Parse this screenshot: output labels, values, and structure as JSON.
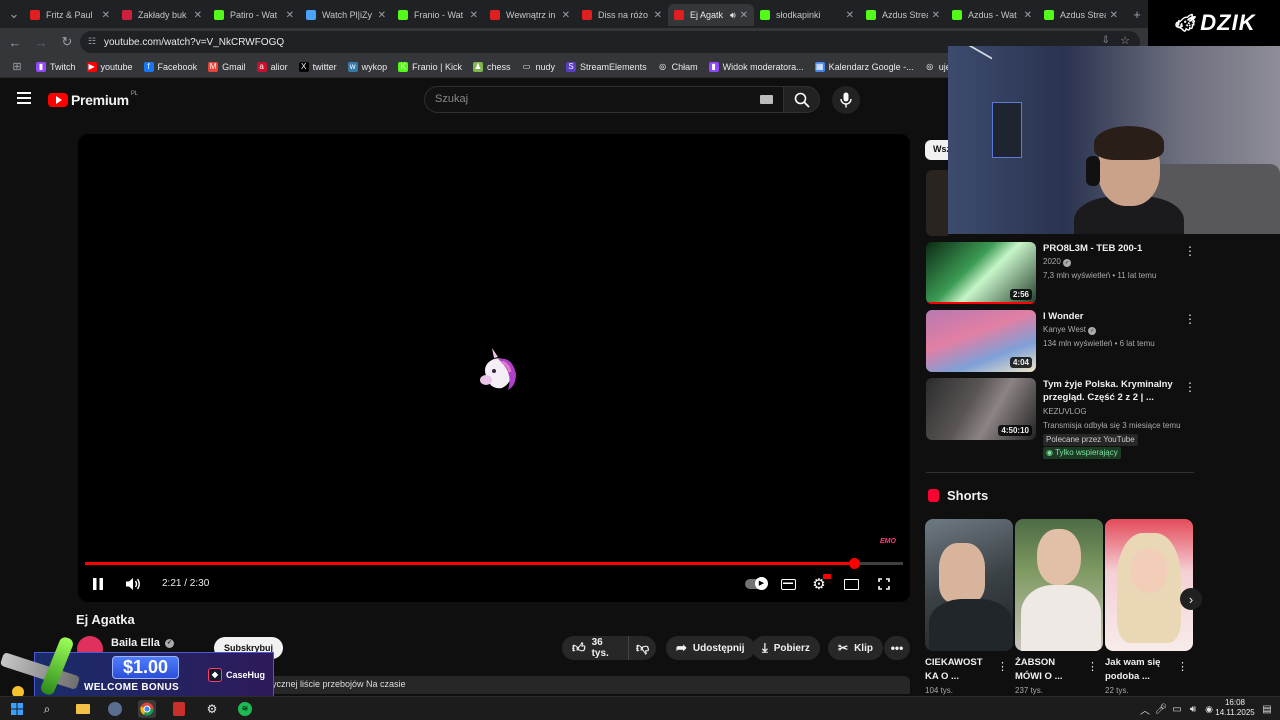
{
  "browser": {
    "tabs": [
      {
        "label": "Fritz & Paul",
        "fav": "#e02020",
        "icon": "youtube-icon"
      },
      {
        "label": "Zakłady buk",
        "fav": "#d01f3c",
        "icon": "bookmaker-icon"
      },
      {
        "label": "Patiro - Wat",
        "fav": "#53fc18",
        "icon": "kick-icon"
      },
      {
        "label": "Watch Pl|iZy",
        "fav": "#4aa3ff",
        "icon": "globe-icon"
      },
      {
        "label": "Franio - Wat",
        "fav": "#53fc18",
        "icon": "kick-icon"
      },
      {
        "label": "Wewnątrz in",
        "fav": "#e02020",
        "icon": "youtube-icon"
      },
      {
        "label": "Diss na różo",
        "fav": "#e02020",
        "icon": "youtube-icon"
      },
      {
        "label": "Ej Agatk",
        "fav": "#e02020",
        "icon": "youtube-icon",
        "active": true
      },
      {
        "label": "słodkapinki",
        "fav": "#53fc18",
        "icon": "kick-icon"
      },
      {
        "label": "Azdus Strea",
        "fav": "#53fc18",
        "icon": "kick-icon"
      },
      {
        "label": "Azdus - Wat",
        "fav": "#53fc18",
        "icon": "kick-icon"
      },
      {
        "label": "Azdus Strea",
        "fav": "#53fc18",
        "icon": "kick-icon"
      }
    ],
    "url": "youtube.com/watch?v=V_NkCRWFOGQ",
    "bookmarks": [
      {
        "label": "Twitch",
        "color": "#9146ff",
        "glyph": "▮"
      },
      {
        "label": "youtube",
        "color": "#ff0000",
        "glyph": "▶"
      },
      {
        "label": "Facebook",
        "color": "#1877f2",
        "glyph": "f"
      },
      {
        "label": "Gmail",
        "color": "#ea4335",
        "glyph": "M"
      },
      {
        "label": "alior",
        "color": "#c8102e",
        "glyph": "a"
      },
      {
        "label": "twitter",
        "color": "#000000",
        "glyph": "X"
      },
      {
        "label": "wykop",
        "color": "#367aa9",
        "glyph": "w"
      },
      {
        "label": "Franio | Kick",
        "color": "#53fc18",
        "glyph": "K"
      },
      {
        "label": "chess",
        "color": "#81b64c",
        "glyph": "♟"
      },
      {
        "label": "nudy",
        "color": "#35363a",
        "glyph": "▭"
      },
      {
        "label": "StreamElements",
        "color": "#5b3cc4",
        "glyph": "S"
      },
      {
        "label": "Chłam",
        "color": "#35363a",
        "glyph": "◎"
      },
      {
        "label": "Widok moderatora...",
        "color": "#9146ff",
        "glyph": "▮"
      },
      {
        "label": "Kalendarz Google -...",
        "color": "#4285f4",
        "glyph": "▦"
      },
      {
        "label": "ujeb link",
        "color": "#35363a",
        "glyph": "◎"
      }
    ]
  },
  "youtube": {
    "logo_text": "Premium",
    "logo_region": "PL",
    "search_placeholder": "Szukaj"
  },
  "player": {
    "time": "2:21 / 2:30",
    "progress": 0.94,
    "watermark": "EMO"
  },
  "video": {
    "title": "Ej Agatka",
    "channel": "Baila Ella",
    "subscribe": "Subskrybuj",
    "likes": "36 tys.",
    "share": "Udostępnij",
    "download": "Pobierz",
    "clip": "Klip",
    "description_snippet": "ycznej liście przebojów Na czasie"
  },
  "sidebar": {
    "chip": "Wsz",
    "recommendations": [
      {
        "title": "PRO8L3M - TEB 200-1",
        "channel": "2020",
        "verified": true,
        "meta": "7,3 mln wyświetleń • 11 lat temu",
        "duration": "2:56",
        "watched": 1.0,
        "thumb": "teb"
      },
      {
        "title": "I Wonder",
        "channel": "Kanye West",
        "verified": true,
        "meta": "134 mln wyświetleń • 6 lat temu",
        "duration": "4:04",
        "watched": 0,
        "thumb": "wonder"
      },
      {
        "title": "Tym żyje Polska. Kryminalny przegląd. Część 2 z 2 | ...",
        "channel": "KEZUVLOG",
        "verified": false,
        "meta": "Transmisja odbyła się 3 miesiące temu",
        "badge1": "Polecane przez YouTube",
        "badge2": "Tylko wspierający",
        "duration": "4:50:10",
        "watched": 0,
        "thumb": "kryminal"
      }
    ],
    "shorts_header": "Shorts",
    "shorts": [
      {
        "title": "CIEKAWOST KA O ...",
        "views": "104 tys."
      },
      {
        "title": "ŻABSON MÓWI O ...",
        "views": "237 tys."
      },
      {
        "title": "Jak wam się podoba ...",
        "views": "22 tys."
      }
    ]
  },
  "overlay": {
    "brand": "DZIK",
    "ad_amount": "$1.00",
    "ad_text": "WELCOME BONUS",
    "ad_brand": "CaseHug"
  },
  "taskbar": {
    "time": "16:08",
    "date": "14.11.2025"
  }
}
